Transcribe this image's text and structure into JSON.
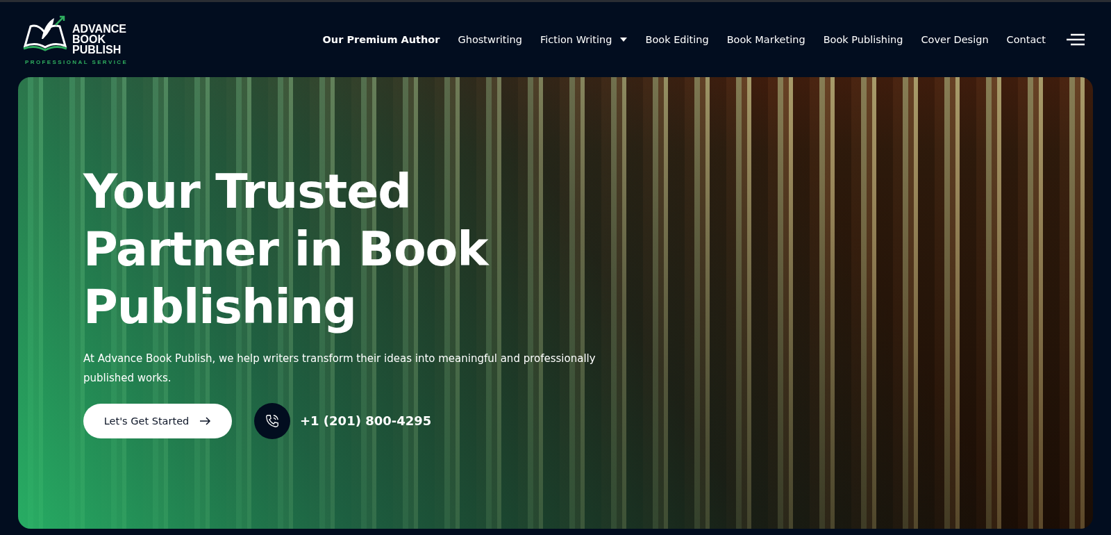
{
  "logo": {
    "name_lines": [
      "ADVANCE",
      "BOOK",
      "PUBLISH"
    ],
    "tagline": "PROFESSIONAL SERVICE"
  },
  "nav": [
    {
      "label": "Our Premium Author",
      "selected": true,
      "has_menu": false
    },
    {
      "label": "Ghostwriting",
      "selected": false,
      "has_menu": false
    },
    {
      "label": "Fiction Writing",
      "selected": false,
      "has_menu": true
    },
    {
      "label": "Book Editing",
      "selected": false,
      "has_menu": false
    },
    {
      "label": "Book Marketing",
      "selected": false,
      "has_menu": false
    },
    {
      "label": "Book Publishing",
      "selected": false,
      "has_menu": false
    },
    {
      "label": "Cover Design",
      "selected": false,
      "has_menu": false
    },
    {
      "label": "Contact",
      "selected": false,
      "has_menu": false
    }
  ],
  "hero": {
    "title": "Your Trusted Partner in Book Publishing",
    "subtitle": "At Advance Book Publish, we help writers transform their ideas into meaningful and professionally published works.",
    "cta": "Let's Get Started",
    "phone": "+1 (201) 800-4295"
  }
}
